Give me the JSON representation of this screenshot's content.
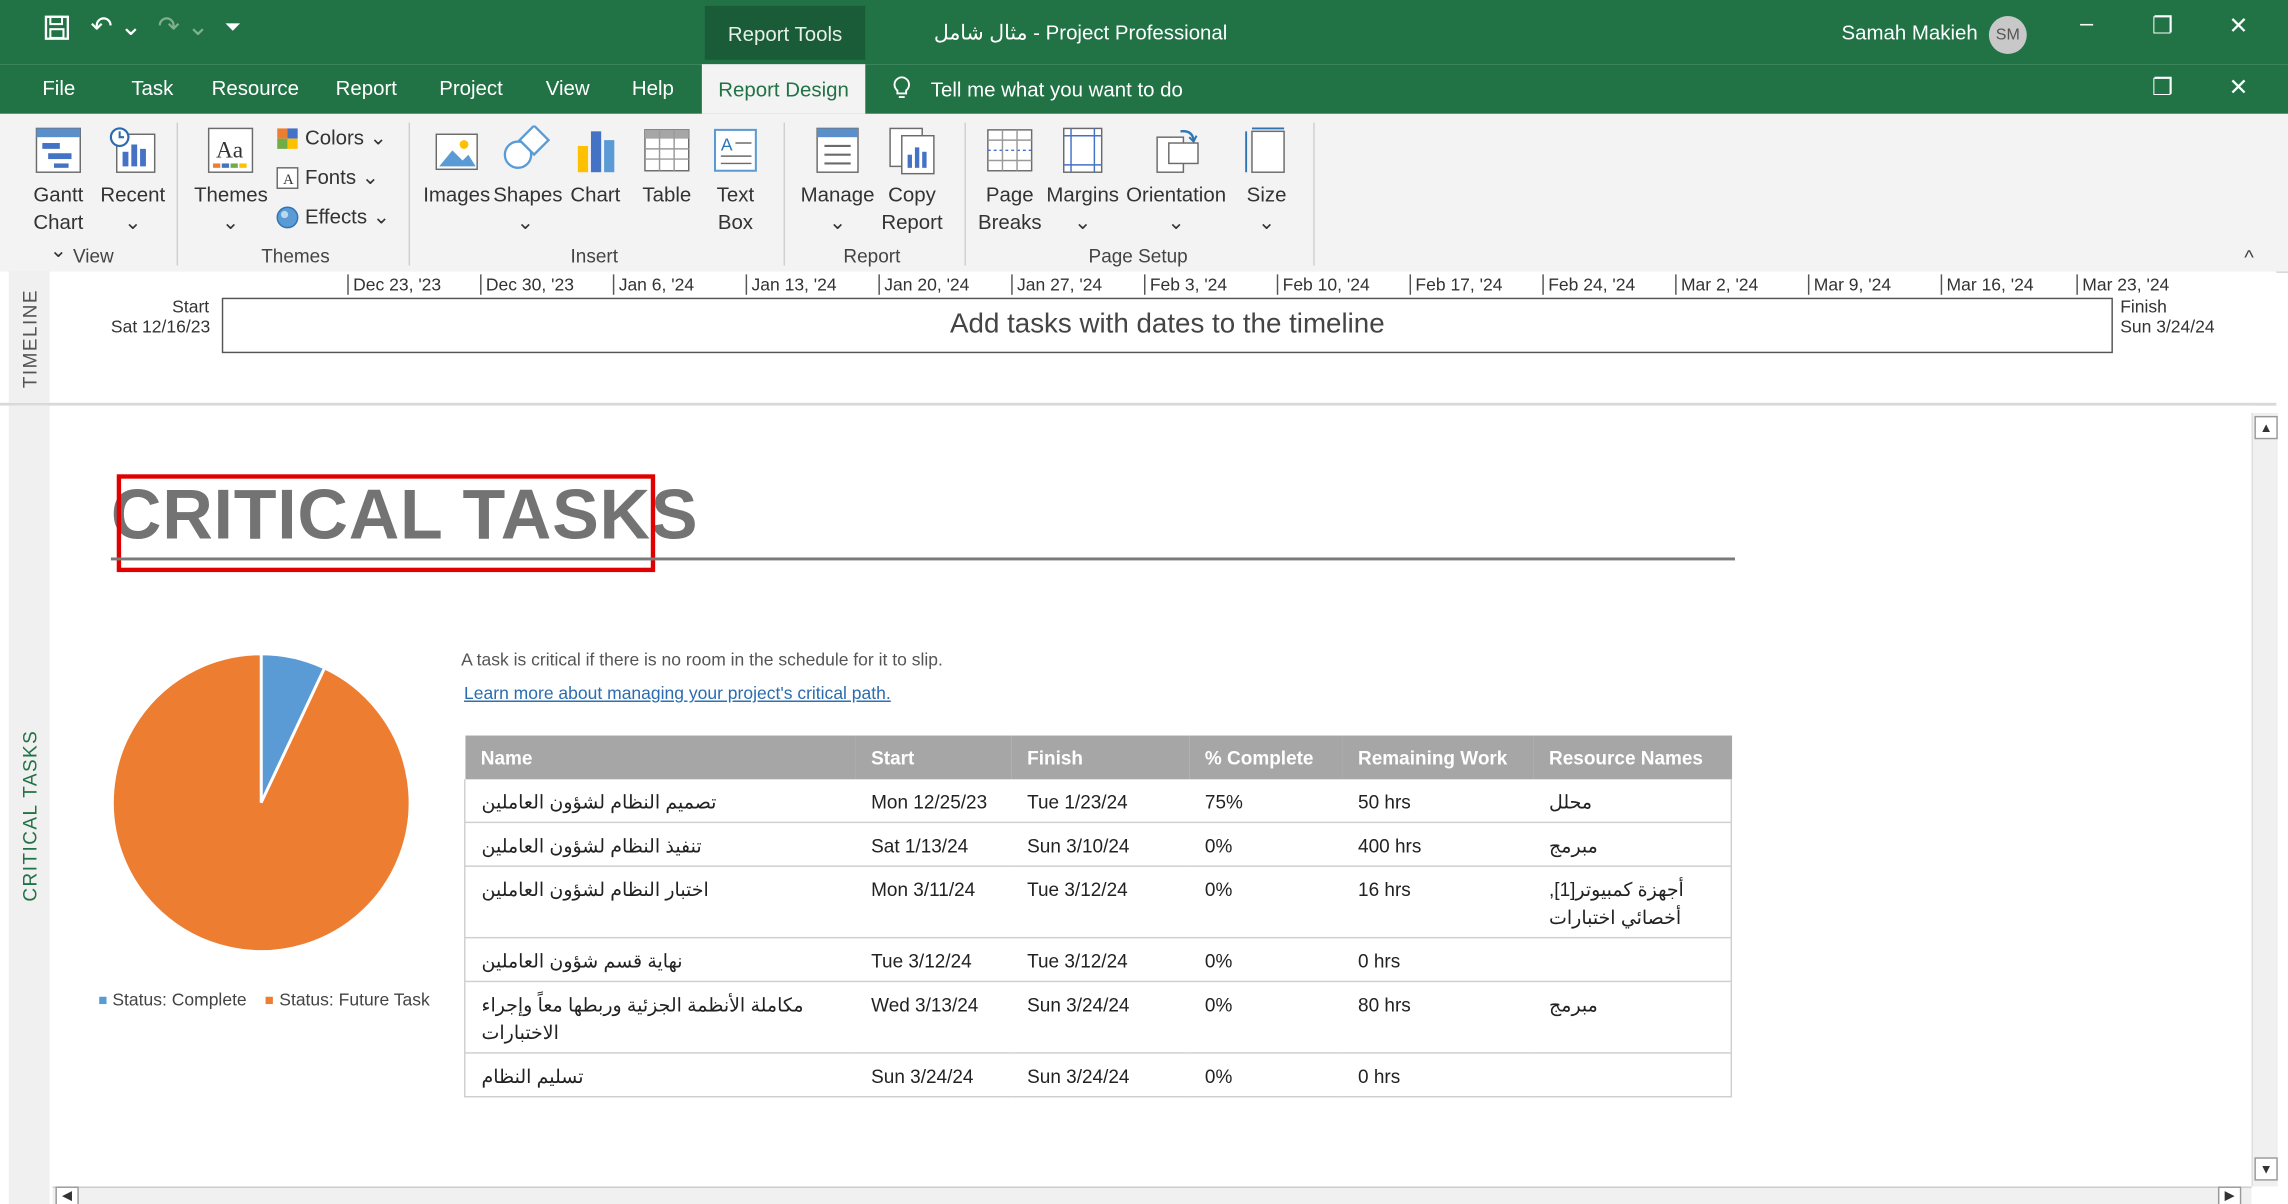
{
  "window": {
    "title": "مثال شامل  -  Project Professional",
    "context_tab": "Report Tools",
    "user_name": "Samah Makieh",
    "user_initials": "SM",
    "minimize": "–",
    "restore": "❐",
    "close": "✕"
  },
  "menu": {
    "tabs": [
      "File",
      "Task",
      "Resource",
      "Report",
      "Project",
      "View",
      "Help"
    ],
    "active_tab": "Report Design",
    "tell_me": "Tell me what you want to do"
  },
  "ribbon": {
    "view": {
      "gantt_1": "Gantt",
      "gantt_2": "Chart ⌄",
      "recent_1": "Recent",
      "recent_2": "⌄",
      "group": "View"
    },
    "themes": {
      "themes_1": "Themes",
      "themes_2": "⌄",
      "colors": "Colors ⌄",
      "fonts": "Fonts ⌄",
      "effects": "Effects ⌄",
      "group": "Themes"
    },
    "insert": {
      "images": "Images",
      "shapes_1": "Shapes",
      "shapes_2": "⌄",
      "chart": "Chart",
      "table": "Table",
      "textbox_1": "Text",
      "textbox_2": "Box",
      "group": "Insert"
    },
    "report": {
      "manage_1": "Manage",
      "manage_2": "⌄",
      "copy_1": "Copy",
      "copy_2": "Report",
      "group": "Report"
    },
    "page_setup": {
      "breaks_1": "Page",
      "breaks_2": "Breaks",
      "margins_1": "Margins",
      "margins_2": "⌄",
      "orientation_1": "Orientation",
      "orientation_2": "⌄",
      "size_1": "Size",
      "size_2": "⌄",
      "group": "Page Setup"
    },
    "collapse": "^"
  },
  "timeline": {
    "side_label": "TIMELINE",
    "start_label": "Start",
    "start_date": "Sat 12/16/23",
    "finish_label": "Finish",
    "finish_date": "Sun 3/24/24",
    "placeholder": "Add tasks with dates to the timeline",
    "ticks": [
      "Dec 23, '23",
      "Dec 30, '23",
      "Jan 6, '24",
      "Jan 13, '24",
      "Jan 20, '24",
      "Jan 27, '24",
      "Feb 3, '24",
      "Feb 10, '24",
      "Feb 17, '24",
      "Feb 24, '24",
      "Mar 2, '24",
      "Mar 9, '24",
      "Mar 16, '24",
      "Mar 23, '24"
    ]
  },
  "report": {
    "side_label": "CRITICAL TASKS",
    "title": "CRITICAL TASKS",
    "description": "A task is critical if there is no room in the schedule for it to slip.",
    "link": "Learn more about managing your project's critical path.",
    "legend": {
      "complete": "Status: Complete",
      "future": "Status: Future Task"
    },
    "table": {
      "headers": [
        "Name",
        "Start",
        "Finish",
        "% Complete",
        "Remaining Work",
        "Resource Names"
      ],
      "rows": [
        [
          "تصميم النظام لشؤون العاملين",
          "Mon 12/25/23",
          "Tue 1/23/24",
          "75%",
          "50 hrs",
          "محلل"
        ],
        [
          "تنفيذ النظام لشؤون العاملين",
          "Sat 1/13/24",
          "Sun 3/10/24",
          "0%",
          "400 hrs",
          "مبرمج"
        ],
        [
          "اختبار النظام لشؤون العاملين",
          "Mon 3/11/24",
          "Tue 3/12/24",
          "0%",
          "16 hrs",
          "أجهزة كمبيوتر[1], أخصائي اختبارات"
        ],
        [
          "نهاية قسم شؤون العاملين",
          "Tue 3/12/24",
          "Tue 3/12/24",
          "0%",
          "0 hrs",
          ""
        ],
        [
          "مكاملة الأنظمة الجزئية وربطها معاً وإجراء الاختبارات",
          "Wed 3/13/24",
          "Sun 3/24/24",
          "0%",
          "80 hrs",
          "مبرمج"
        ],
        [
          "تسليم النظام",
          "Sun 3/24/24",
          "Sun 3/24/24",
          "0%",
          "0 hrs",
          ""
        ]
      ]
    }
  },
  "chart_data": {
    "type": "pie",
    "categories": [
      "Status: Complete",
      "Status: Future Task"
    ],
    "values": [
      7,
      93
    ],
    "colors": [
      "#5b9bd5",
      "#ed7d31"
    ],
    "legend": "bottom"
  },
  "colors": {
    "accent": "#217346",
    "highlight": "#e00000"
  }
}
